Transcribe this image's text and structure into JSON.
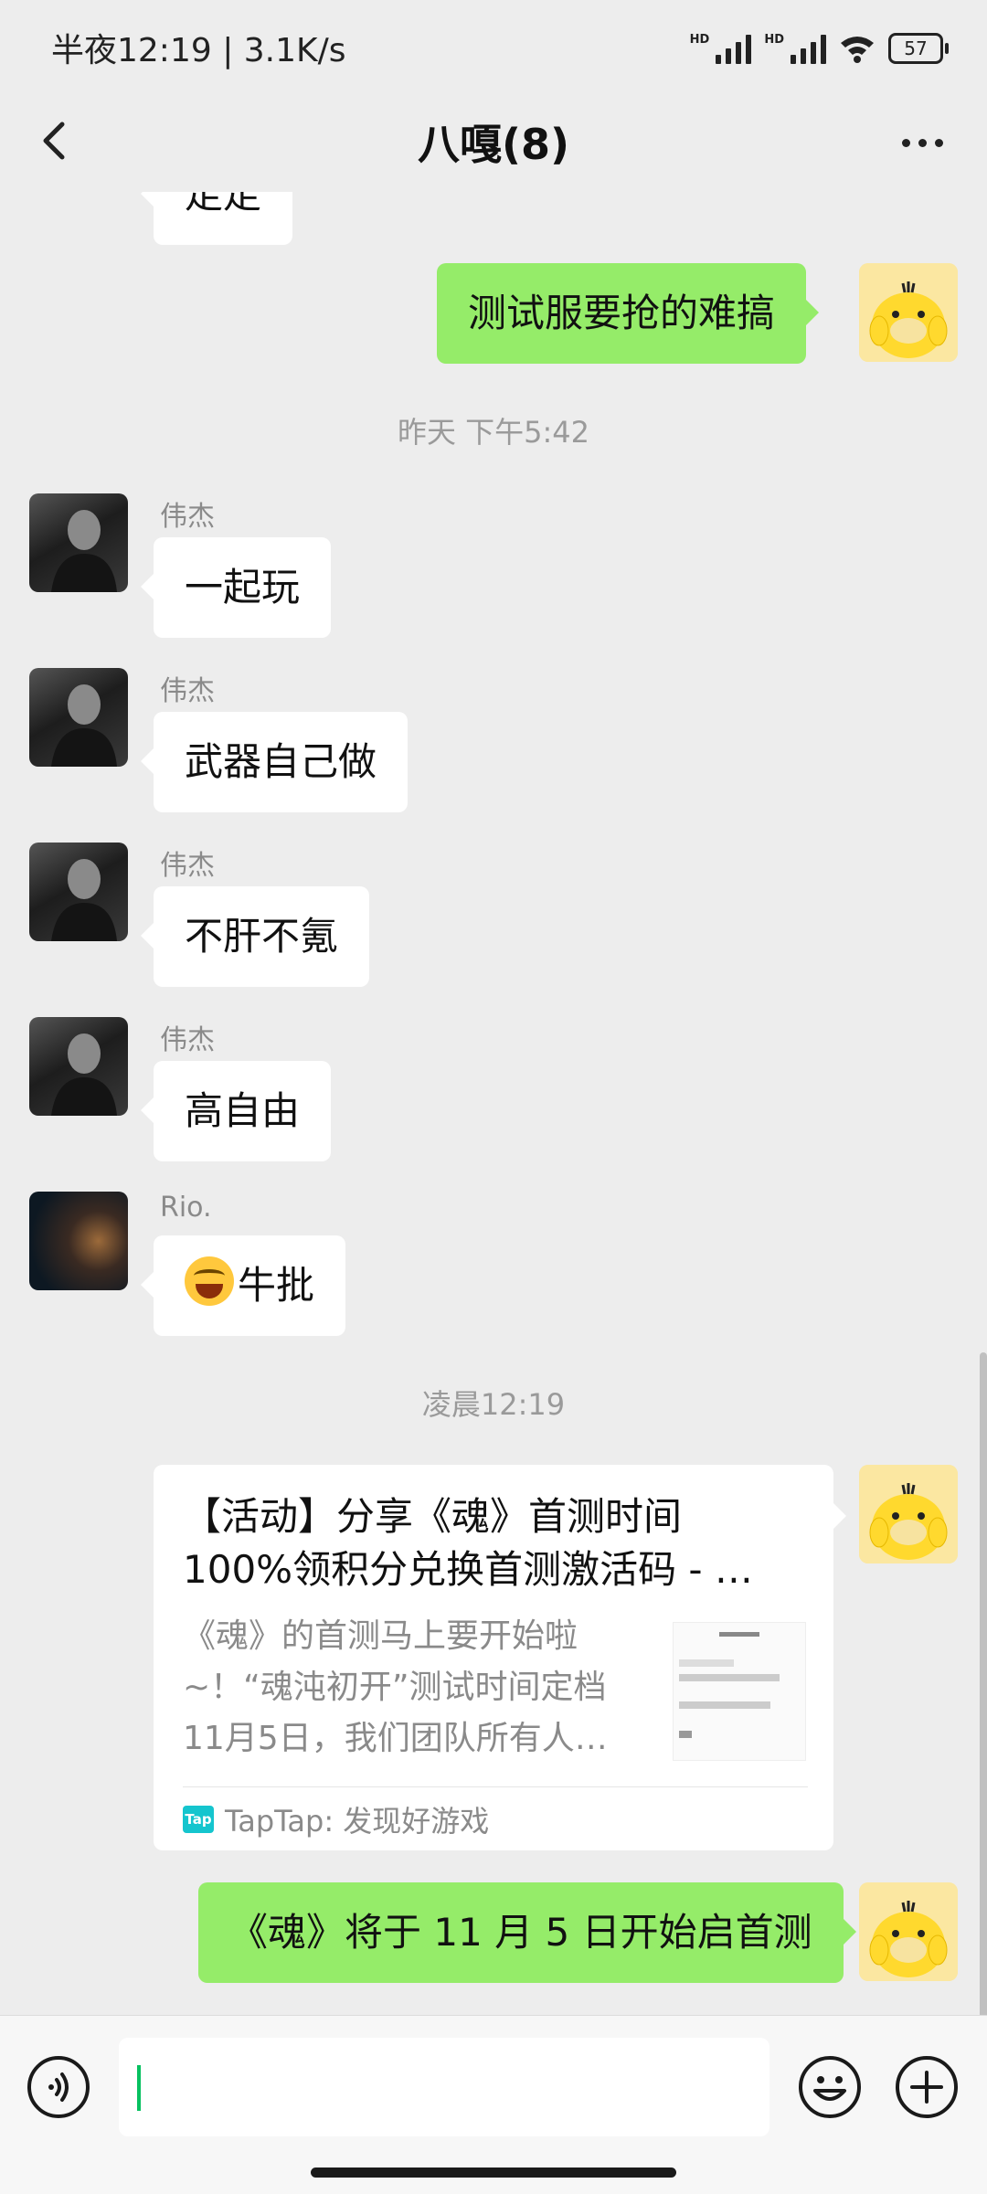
{
  "status_bar": {
    "left_text": "半夜12:19 | 3.1K/s",
    "signal_1_label": "HD",
    "signal_2_label": "HD",
    "battery": "57"
  },
  "header": {
    "title": "八嘎(8)"
  },
  "chat": {
    "top_partial_text": "走走",
    "messages": [
      {
        "sender": "me",
        "text": "测试服要抢的难搞"
      },
      {
        "timestamp": "昨天 下午5:42"
      },
      {
        "sender": "伟杰",
        "text": "一起玩"
      },
      {
        "sender": "伟杰",
        "text": "武器自己做"
      },
      {
        "sender": "伟杰",
        "text": "不肝不氪"
      },
      {
        "sender": "伟杰",
        "text": "高自由"
      },
      {
        "sender": "Rio.",
        "emoji": "tears-of-joy",
        "text": "牛批"
      },
      {
        "timestamp": "凌晨12:19"
      },
      {
        "sender": "me",
        "card": {
          "title_line1": "【活动】分享《魂》首测时间",
          "title_line2": "100%领积分兑换首测激活码 - …",
          "desc_line1": "《魂》的首测马上要开始啦",
          "desc_line2": "~！“魂沌初开”测试时间定档",
          "desc_line3": "11月5日，我们团队所有人…",
          "source": "TapTap: 发现好游戏",
          "source_logo": "Tap"
        }
      },
      {
        "sender": "me",
        "text": "《魂》将于 11 月 5 日开始启首测"
      }
    ]
  },
  "colors": {
    "outgoing_bubble": "#95ec69",
    "incoming_bubble": "#ffffff",
    "background": "#ededed",
    "taptap_brand": "#15c5ce"
  }
}
